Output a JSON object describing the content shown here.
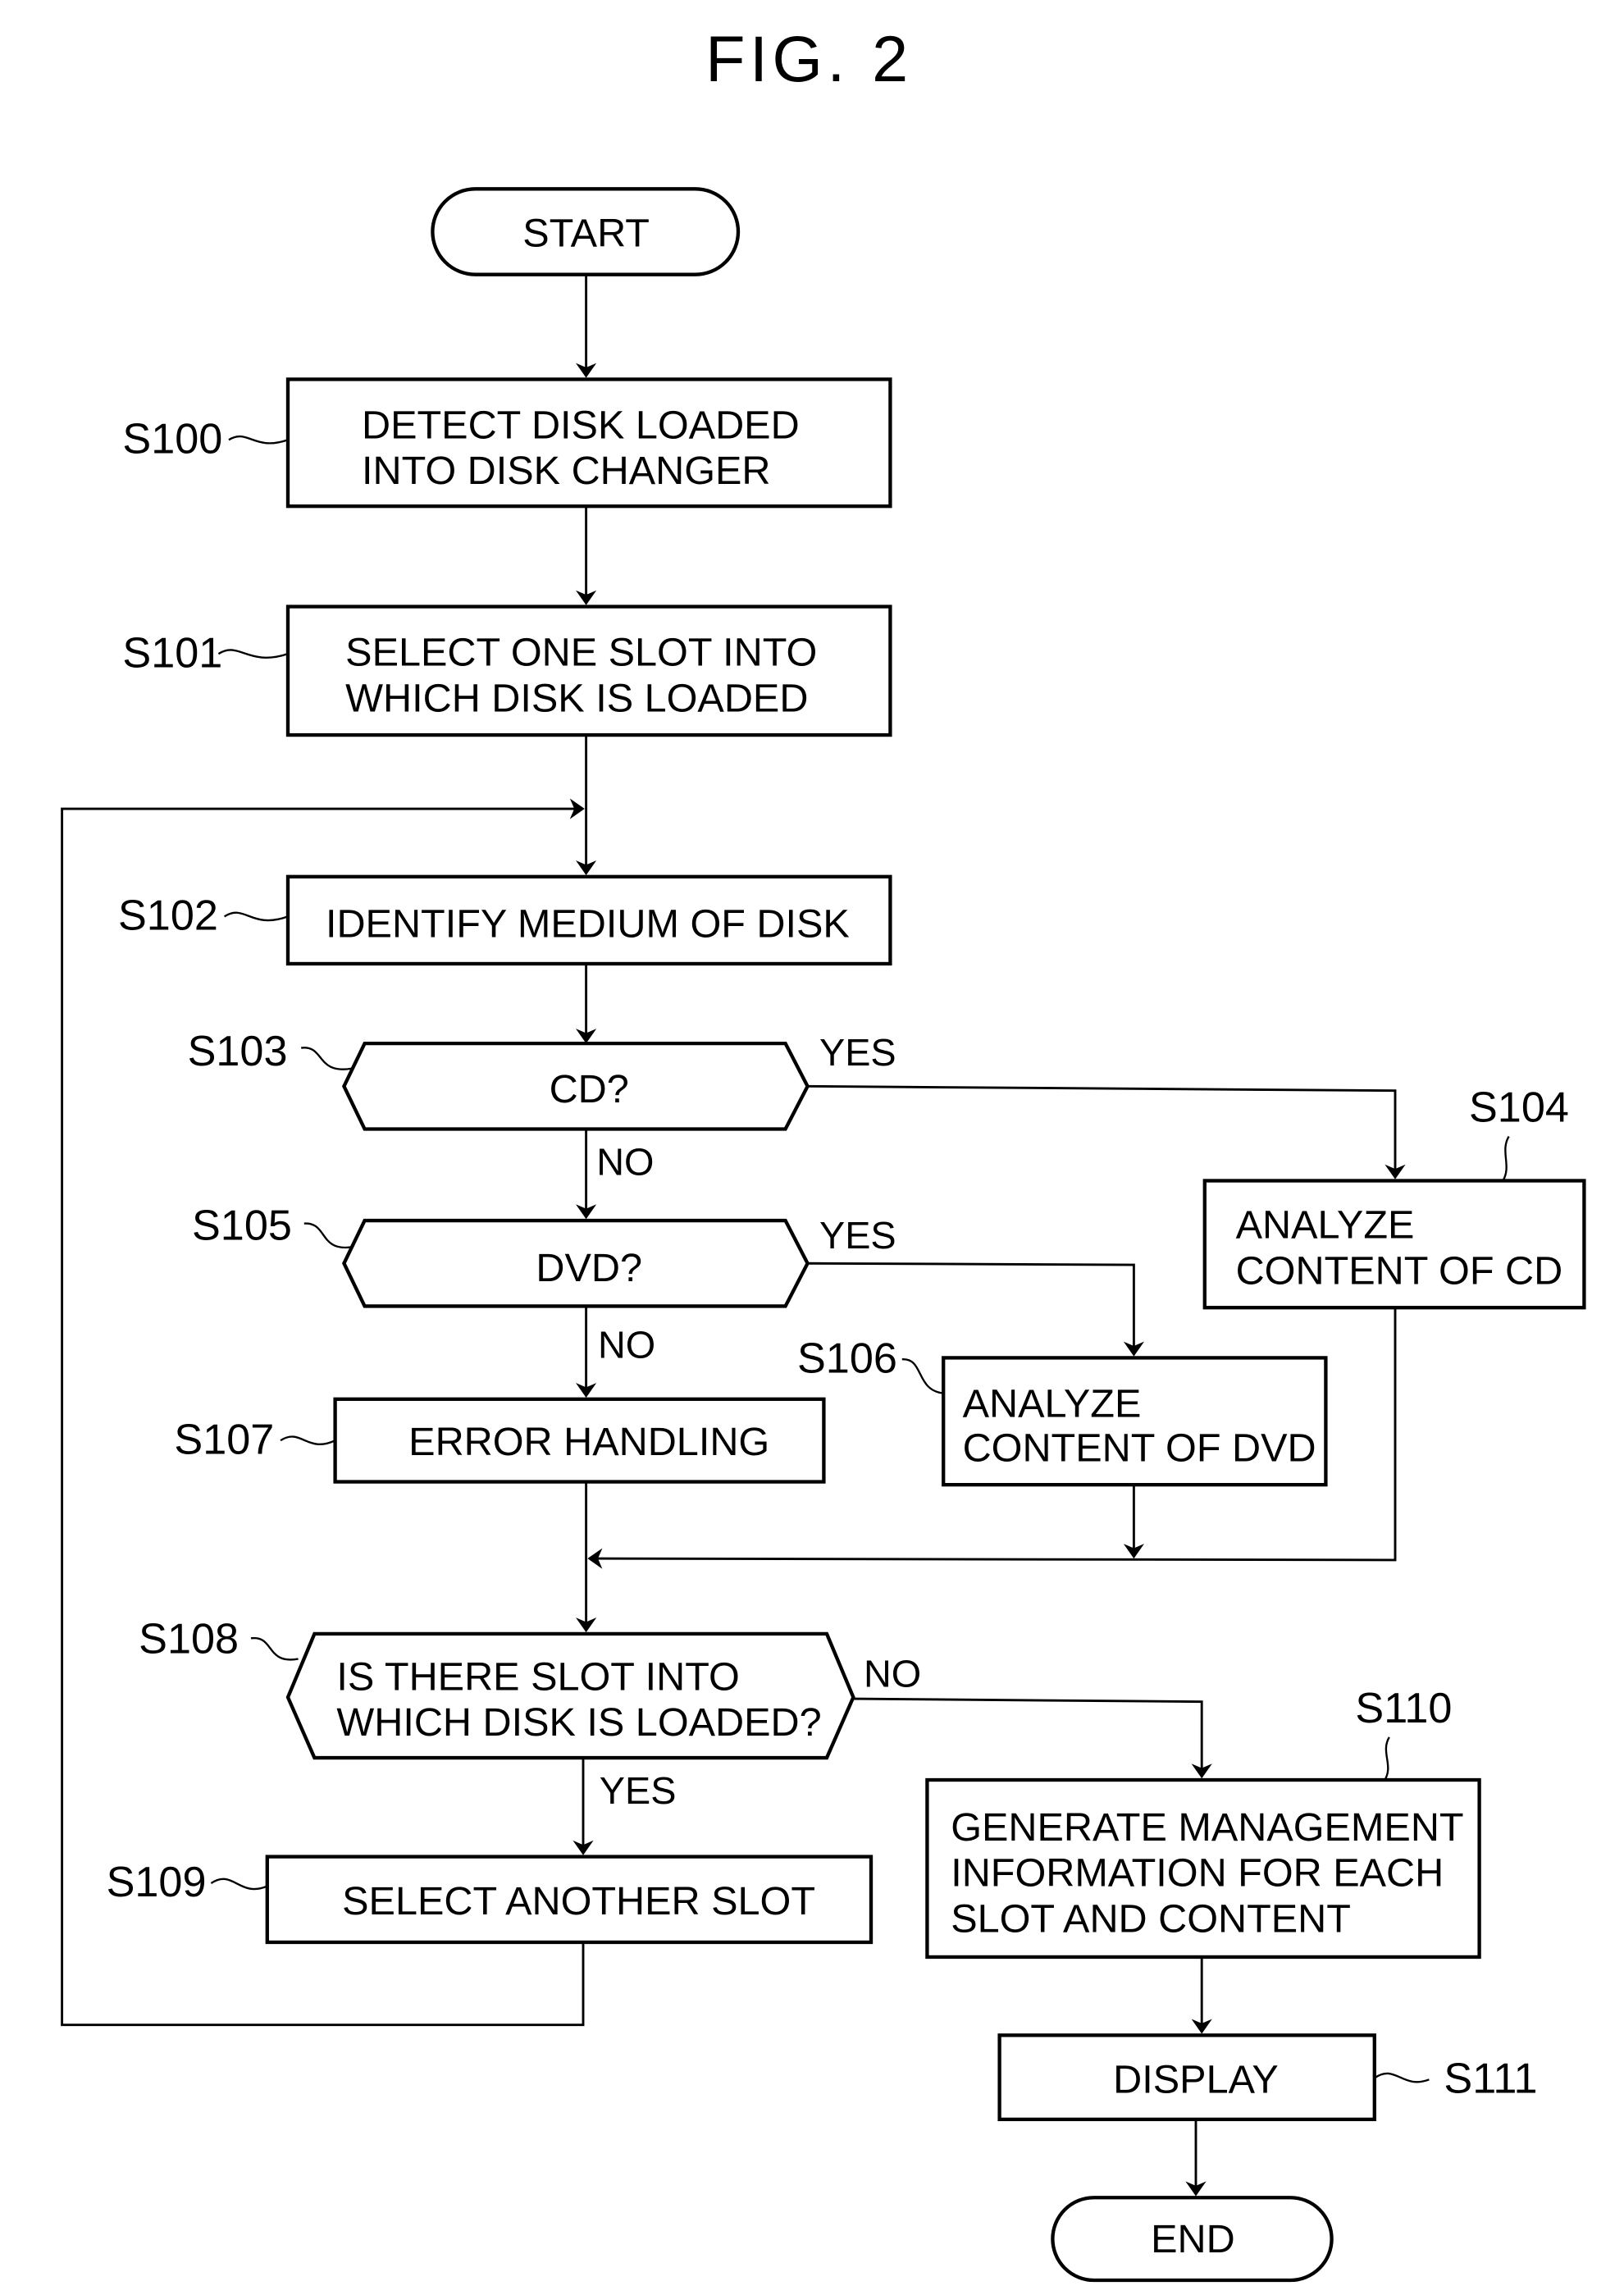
{
  "figure": {
    "title": "FIG. 2",
    "colors": {
      "stroke": "#000000",
      "background": "#ffffff"
    }
  },
  "nodes": {
    "start": {
      "type": "terminal",
      "lines": [
        "START"
      ]
    },
    "s100": {
      "step": "S100",
      "type": "process",
      "lines": [
        "DETECT DISK LOADED",
        "INTO DISK CHANGER"
      ]
    },
    "s101": {
      "step": "S101",
      "type": "process",
      "lines": [
        "SELECT ONE SLOT INTO",
        "WHICH DISK IS LOADED"
      ]
    },
    "s102": {
      "step": "S102",
      "type": "process",
      "lines": [
        "IDENTIFY MEDIUM OF DISK"
      ]
    },
    "s103": {
      "step": "S103",
      "type": "decision",
      "lines": [
        "CD?"
      ],
      "yes": "YES",
      "no": "NO"
    },
    "s104": {
      "step": "S104",
      "type": "process",
      "lines": [
        "ANALYZE",
        "CONTENT OF CD"
      ]
    },
    "s105": {
      "step": "S105",
      "type": "decision",
      "lines": [
        "DVD?"
      ],
      "yes": "YES",
      "no": "NO"
    },
    "s106": {
      "step": "S106",
      "type": "process",
      "lines": [
        "ANALYZE",
        "CONTENT OF DVD"
      ]
    },
    "s107": {
      "step": "S107",
      "type": "process",
      "lines": [
        "ERROR HANDLING"
      ]
    },
    "s108": {
      "step": "S108",
      "type": "decision",
      "lines": [
        "IS THERE SLOT INTO",
        "WHICH DISK IS LOADED?"
      ],
      "yes": "YES",
      "no": "NO"
    },
    "s109": {
      "step": "S109",
      "type": "process",
      "lines": [
        "SELECT ANOTHER SLOT"
      ]
    },
    "s110": {
      "step": "S110",
      "type": "process",
      "lines": [
        "GENERATE MANAGEMENT",
        "INFORMATION FOR EACH",
        "SLOT AND CONTENT"
      ]
    },
    "s111": {
      "step": "S111",
      "type": "process",
      "lines": [
        "DISPLAY"
      ]
    },
    "end": {
      "type": "terminal",
      "lines": [
        "END"
      ]
    }
  },
  "edges": [
    {
      "from": "start",
      "to": "s100"
    },
    {
      "from": "s100",
      "to": "s101"
    },
    {
      "from": "s101",
      "to": "s102"
    },
    {
      "from": "s102",
      "to": "s103"
    },
    {
      "from": "s103",
      "to": "s104",
      "label": "YES"
    },
    {
      "from": "s103",
      "to": "s105",
      "label": "NO"
    },
    {
      "from": "s105",
      "to": "s106",
      "label": "YES"
    },
    {
      "from": "s105",
      "to": "s107",
      "label": "NO"
    },
    {
      "from": "s104",
      "to": "s108"
    },
    {
      "from": "s106",
      "to": "s108"
    },
    {
      "from": "s107",
      "to": "s108"
    },
    {
      "from": "s108",
      "to": "s109",
      "label": "YES"
    },
    {
      "from": "s108",
      "to": "s110",
      "label": "NO"
    },
    {
      "from": "s109",
      "to": "s102"
    },
    {
      "from": "s110",
      "to": "s111"
    },
    {
      "from": "s111",
      "to": "end"
    }
  ]
}
